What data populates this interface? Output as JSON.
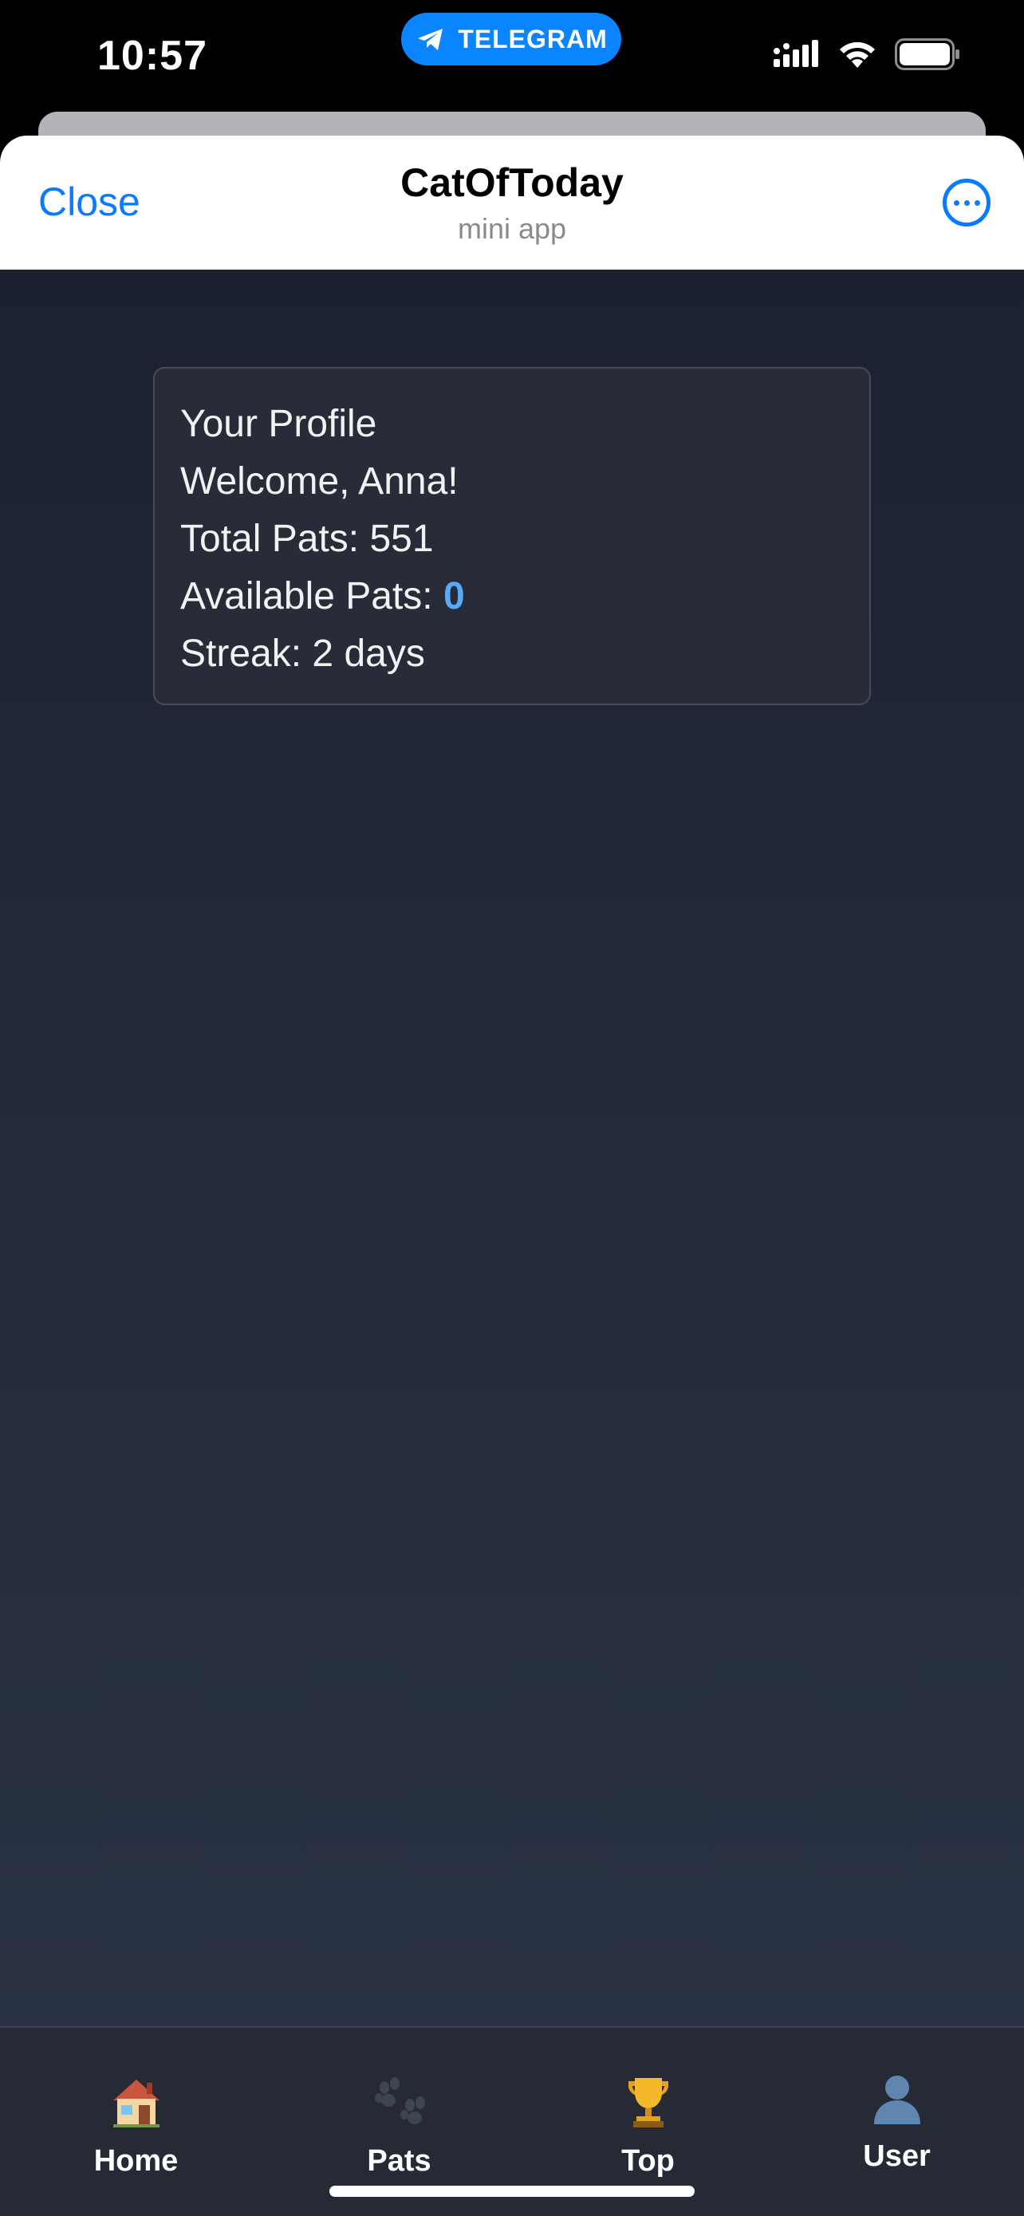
{
  "status_bar": {
    "time": "10:57",
    "pill_label": "TELEGRAM"
  },
  "header": {
    "close_label": "Close",
    "title": "CatOfToday",
    "subtitle": "mini app"
  },
  "profile": {
    "heading": "Your Profile",
    "welcome": "Welcome, Anna!",
    "total_pats_label": "Total Pats:",
    "total_pats_value": "551",
    "available_pats_label": "Available Pats:",
    "available_pats_value": "0",
    "streak_label": "Streak:",
    "streak_value": "2 days"
  },
  "nav": {
    "items": [
      {
        "label": "Home",
        "icon": "house-icon"
      },
      {
        "label": "Pats",
        "icon": "paw-icon"
      },
      {
        "label": "Top",
        "icon": "trophy-icon"
      },
      {
        "label": "User",
        "icon": "user-silhouette-icon"
      }
    ]
  },
  "colors": {
    "telegram_blue": "#0b84ff",
    "link_blue": "#0a7aff",
    "accent_value": "#5aa9f5",
    "app_background": "#1c2130",
    "card_background": "#272c38",
    "nav_background": "#252a35"
  }
}
